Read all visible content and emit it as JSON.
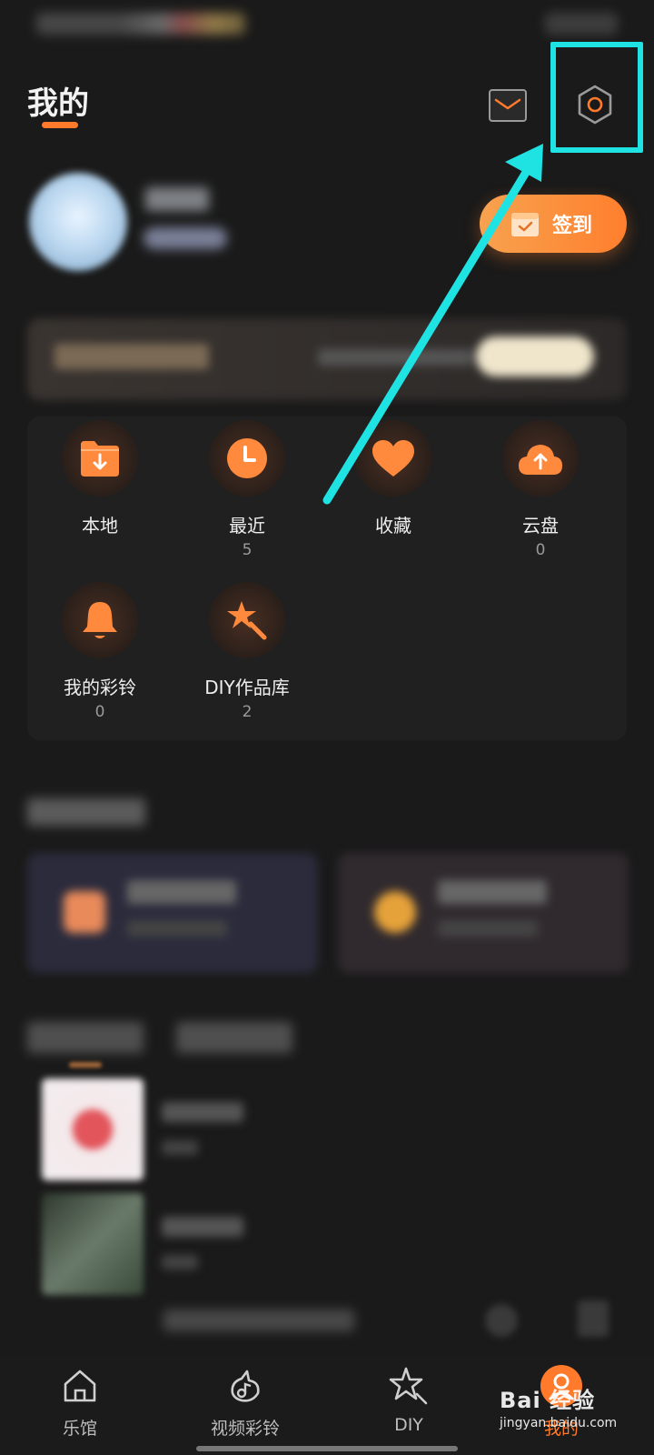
{
  "header": {
    "title": "我的"
  },
  "checkin": {
    "label": "签到"
  },
  "grid": [
    {
      "label": "本地",
      "count": "",
      "icon": "download-folder-icon"
    },
    {
      "label": "最近",
      "count": "5",
      "icon": "clock-icon"
    },
    {
      "label": "收藏",
      "count": "",
      "icon": "heart-icon"
    },
    {
      "label": "云盘",
      "count": "0",
      "icon": "cloud-upload-icon"
    },
    {
      "label": "我的彩铃",
      "count": "0",
      "icon": "bell-icon"
    },
    {
      "label": "DIY作品库",
      "count": "2",
      "icon": "magic-star-icon"
    }
  ],
  "bottom_nav": [
    {
      "label": "乐馆",
      "icon": "home-icon",
      "active": false
    },
    {
      "label": "视频彩铃",
      "icon": "music-bird-icon",
      "active": false
    },
    {
      "label": "DIY",
      "icon": "star-icon",
      "active": false
    },
    {
      "label": "我的",
      "icon": "profile-icon",
      "active": true
    }
  ],
  "watermark": {
    "main": "Bai 经验",
    "sub": "jingyan.baidu.com"
  },
  "colors": {
    "accent": "#ff7a2b",
    "highlight": "#1fe3e3",
    "background": "#1a1a1a"
  }
}
